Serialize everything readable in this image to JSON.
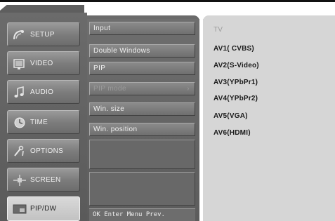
{
  "tabs": [
    {
      "label": "SETUP",
      "icon": "satellite-dish-icon"
    },
    {
      "label": "VIDEO",
      "icon": "tv-icon"
    },
    {
      "label": "AUDIO",
      "icon": "music-note-icon"
    },
    {
      "label": "TIME",
      "icon": "clock-icon"
    },
    {
      "label": "OPTIONS",
      "icon": "tools-icon"
    },
    {
      "label": "SCREEN",
      "icon": "screen-adjust-icon"
    },
    {
      "label": "PIP/DW",
      "icon": "pip-icon",
      "active": true
    }
  ],
  "menu": {
    "items": [
      {
        "label": "Input",
        "enabled": true
      },
      {
        "label": "Double Windows",
        "enabled": true
      },
      {
        "label": "PIP",
        "enabled": true
      },
      {
        "label": "PIP mode",
        "enabled": false
      },
      {
        "label": "Win. size",
        "enabled": true
      },
      {
        "label": "Win. position",
        "enabled": true
      }
    ],
    "submenu_arrow": "›",
    "footer": "OK Enter Menu Prev."
  },
  "options": [
    {
      "label": "TV",
      "dim": true
    },
    {
      "label": "AV1( CVBS)",
      "dim": false
    },
    {
      "label": "AV2(S-Video)",
      "dim": false
    },
    {
      "label": "AV3(YPbPr1)",
      "dim": false
    },
    {
      "label": "AV4(YPbPr2)",
      "dim": false
    },
    {
      "label": "AV5(VGA)",
      "dim": false
    },
    {
      "label": "AV6(HDMI)",
      "dim": false
    }
  ],
  "colors": {
    "panel": "#6b6b6b",
    "active_tab": "#cfcfcf",
    "options_bg": "#d6d6d6",
    "text_light": "#f0f0f0",
    "text_dark": "#1a1a1a"
  }
}
